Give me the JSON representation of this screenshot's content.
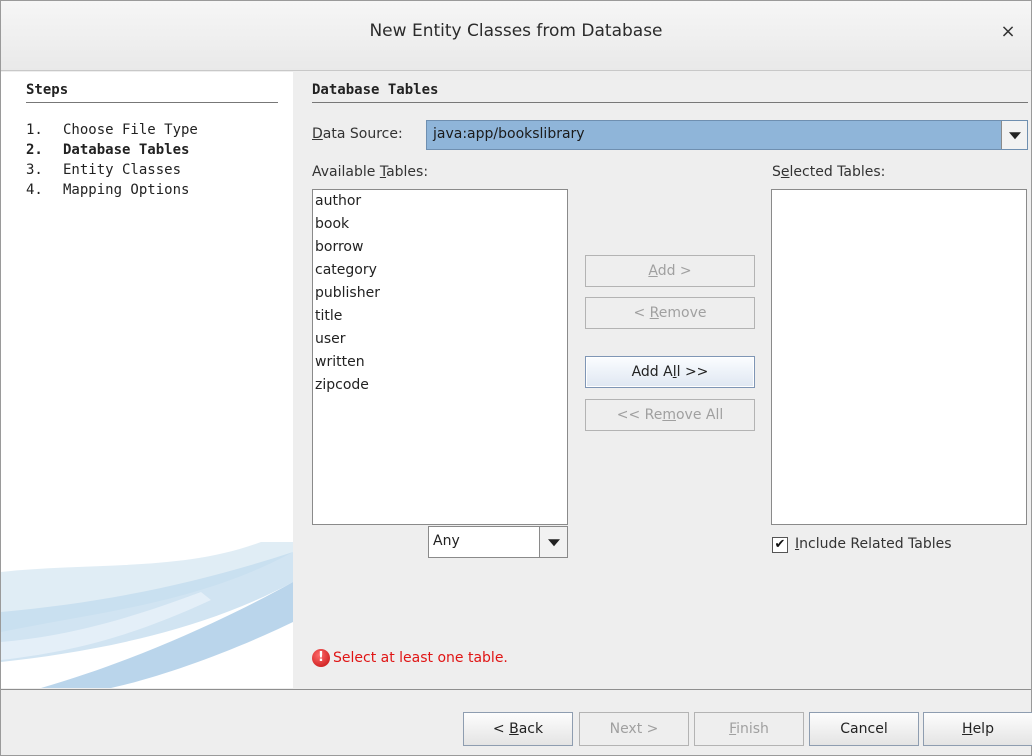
{
  "window": {
    "title": "New Entity Classes from Database",
    "close_glyph": "×"
  },
  "steps": {
    "heading": "Steps",
    "items": [
      {
        "num": "1.",
        "label": "Choose File Type",
        "active": false
      },
      {
        "num": "2.",
        "label": "Database Tables",
        "active": true
      },
      {
        "num": "3.",
        "label": "Entity Classes",
        "active": false
      },
      {
        "num": "4.",
        "label": "Mapping Options",
        "active": false
      }
    ]
  },
  "main": {
    "section_title": "Database Tables",
    "data_source": {
      "label_mnemonic": "D",
      "label_rest": "ata Source:",
      "value": "java:app/bookslibrary"
    },
    "available": {
      "label_pre": "Available ",
      "label_mnemonic": "T",
      "label_post": "ables:",
      "tables": [
        "author",
        "book",
        "borrow",
        "category",
        "publisher",
        "title",
        "user",
        "written",
        "zipcode"
      ],
      "filter_value": "Any"
    },
    "selected": {
      "label_pre": "S",
      "label_mnemonic": "e",
      "label_post": "lected Tables:",
      "tables": []
    },
    "buttons": {
      "add": {
        "mnemonic": "A",
        "rest": "dd >",
        "enabled": false
      },
      "remove": {
        "pre": "< ",
        "mnemonic": "R",
        "rest": "emove",
        "enabled": false
      },
      "add_all": {
        "pre": "Add A",
        "mnemonic": "l",
        "rest": "l >>",
        "enabled": true
      },
      "remove_all": {
        "pre": "<< Re",
        "mnemonic": "m",
        "rest": "ove All",
        "enabled": false
      }
    },
    "include_related": {
      "checked": true,
      "check_glyph": "✔",
      "mnemonic": "I",
      "rest": "nclude Related Tables"
    },
    "error": {
      "icon": "error-icon",
      "glyph": "!",
      "message": "Select at least one table."
    }
  },
  "footer": {
    "back": {
      "pre": "< ",
      "mnemonic": "B",
      "rest": "ack",
      "enabled": true
    },
    "next": {
      "label": "Next >",
      "enabled": false
    },
    "finish": {
      "mnemonic": "F",
      "rest": "inish",
      "enabled": false
    },
    "cancel": {
      "label": "Cancel",
      "enabled": true
    },
    "help": {
      "mnemonic": "H",
      "rest": "elp",
      "enabled": true
    }
  }
}
